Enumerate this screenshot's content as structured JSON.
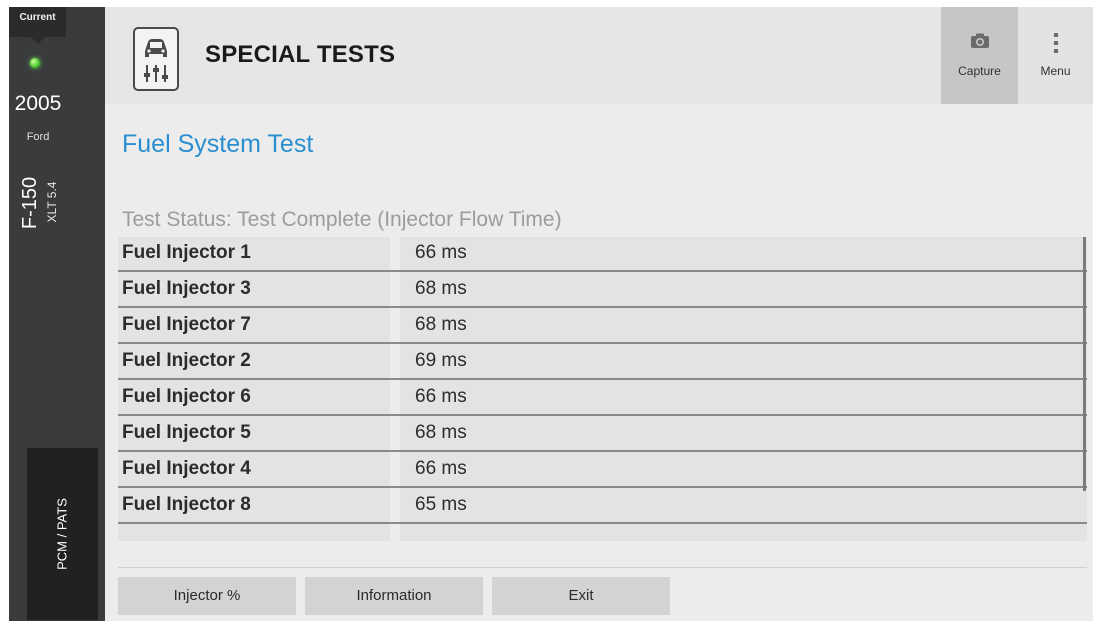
{
  "sidebar": {
    "current_label": "Current",
    "status_icon": "green-led-icon",
    "year": "2005",
    "make": "Ford",
    "model": "F-150",
    "trim": "XLT 5.4",
    "module_label": "PCM / PATS"
  },
  "header": {
    "title": "SPECIAL TESTS",
    "icon": "vehicle-adjust-icon",
    "capture_label": "Capture",
    "capture_icon": "camera-icon",
    "menu_label": "Menu",
    "menu_icon": "more-vertical-icon"
  },
  "page": {
    "title": "Fuel System Test",
    "status": "Test Status: Test Complete (Injector Flow Time)"
  },
  "results": [
    {
      "name": "Fuel Injector 1",
      "value": "66 ms"
    },
    {
      "name": "Fuel Injector 3",
      "value": "68 ms"
    },
    {
      "name": "Fuel Injector 7",
      "value": "68 ms"
    },
    {
      "name": "Fuel Injector 2",
      "value": "69 ms"
    },
    {
      "name": "Fuel Injector 6",
      "value": "66 ms"
    },
    {
      "name": "Fuel Injector 5",
      "value": "68 ms"
    },
    {
      "name": "Fuel Injector 4",
      "value": "66 ms"
    },
    {
      "name": "Fuel Injector 8",
      "value": "65 ms"
    }
  ],
  "footer": {
    "buttons": [
      "Injector %",
      "Information",
      "Exit"
    ]
  },
  "colors": {
    "title_blue": "#2a8fd0",
    "rail_dark": "#3a3b3d",
    "led_green": "#4fcf35"
  }
}
